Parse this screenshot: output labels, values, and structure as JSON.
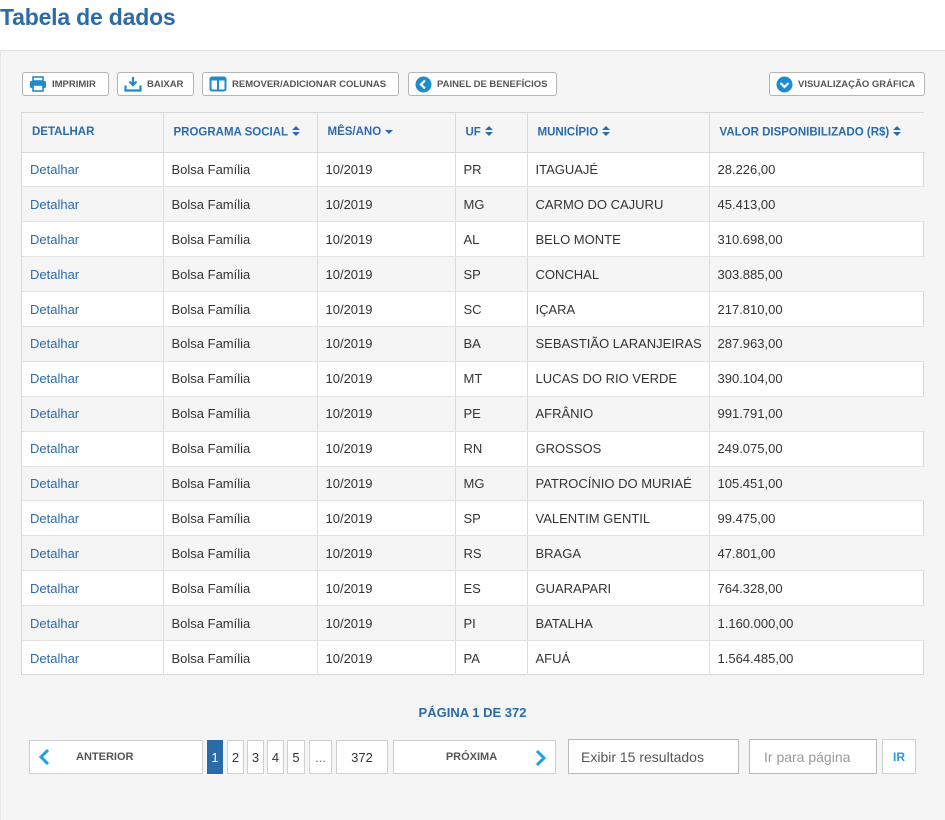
{
  "page": {
    "title": "Tabela de dados"
  },
  "toolbar": {
    "print_label": "IMPRIMIR",
    "download_label": "BAIXAR",
    "columns_label": "REMOVER/ADICIONAR COLUNAS",
    "benefits_label": "PAINEL DE BENEFÍCIOS",
    "chart_label": "VISUALIZAÇÃO GRÁFICA"
  },
  "table": {
    "headers": [
      "DETALHAR",
      "PROGRAMA SOCIAL",
      "MÊS/ANO",
      "UF",
      "MUNICÍPIO",
      "VALOR DISPONIBILIZADO (R$)"
    ],
    "rows": [
      [
        "Detalhar",
        "Bolsa Família",
        "10/2019",
        "PR",
        "ITAGUAJÉ",
        "28.226,00"
      ],
      [
        "Detalhar",
        "Bolsa Família",
        "10/2019",
        "MG",
        "CARMO DO CAJURU",
        "45.413,00"
      ],
      [
        "Detalhar",
        "Bolsa Família",
        "10/2019",
        "AL",
        "BELO MONTE",
        "310.698,00"
      ],
      [
        "Detalhar",
        "Bolsa Família",
        "10/2019",
        "SP",
        "CONCHAL",
        "303.885,00"
      ],
      [
        "Detalhar",
        "Bolsa Família",
        "10/2019",
        "SC",
        "IÇARA",
        "217.810,00"
      ],
      [
        "Detalhar",
        "Bolsa Família",
        "10/2019",
        "BA",
        "SEBASTIÃO LARANJEIRAS",
        "287.963,00"
      ],
      [
        "Detalhar",
        "Bolsa Família",
        "10/2019",
        "MT",
        "LUCAS DO RIO VERDE",
        "390.104,00"
      ],
      [
        "Detalhar",
        "Bolsa Família",
        "10/2019",
        "PE",
        "AFRÂNIO",
        "991.791,00"
      ],
      [
        "Detalhar",
        "Bolsa Família",
        "10/2019",
        "RN",
        "GROSSOS",
        "249.075,00"
      ],
      [
        "Detalhar",
        "Bolsa Família",
        "10/2019",
        "MG",
        "PATROCÍNIO DO MURIAÉ",
        "105.451,00"
      ],
      [
        "Detalhar",
        "Bolsa Família",
        "10/2019",
        "SP",
        "VALENTIM GENTIL",
        "99.475,00"
      ],
      [
        "Detalhar",
        "Bolsa Família",
        "10/2019",
        "RS",
        "BRAGA",
        "47.801,00"
      ],
      [
        "Detalhar",
        "Bolsa Família",
        "10/2019",
        "ES",
        "GUARAPARI",
        "764.328,00"
      ],
      [
        "Detalhar",
        "Bolsa Família",
        "10/2019",
        "PI",
        "BATALHA",
        "1.160.000,00"
      ],
      [
        "Detalhar",
        "Bolsa Família",
        "10/2019",
        "PA",
        "AFUÁ",
        "1.564.485,00"
      ]
    ]
  },
  "pagination": {
    "info": "PÁGINA 1 DE 372",
    "prev_label": "ANTERIOR",
    "next_label": "PRÓXIMA",
    "pages": [
      "1",
      "2",
      "3",
      "4",
      "5"
    ],
    "ellipsis": "...",
    "last_page": "372",
    "current_page": "1",
    "results_label": "Exibir 15 resultados",
    "goto_placeholder": "Ir para página",
    "goto_button": "IR"
  },
  "colors": {
    "accent": "#2c6ba9",
    "link": "#2c6ba9",
    "arrow": "#1da1e2"
  }
}
